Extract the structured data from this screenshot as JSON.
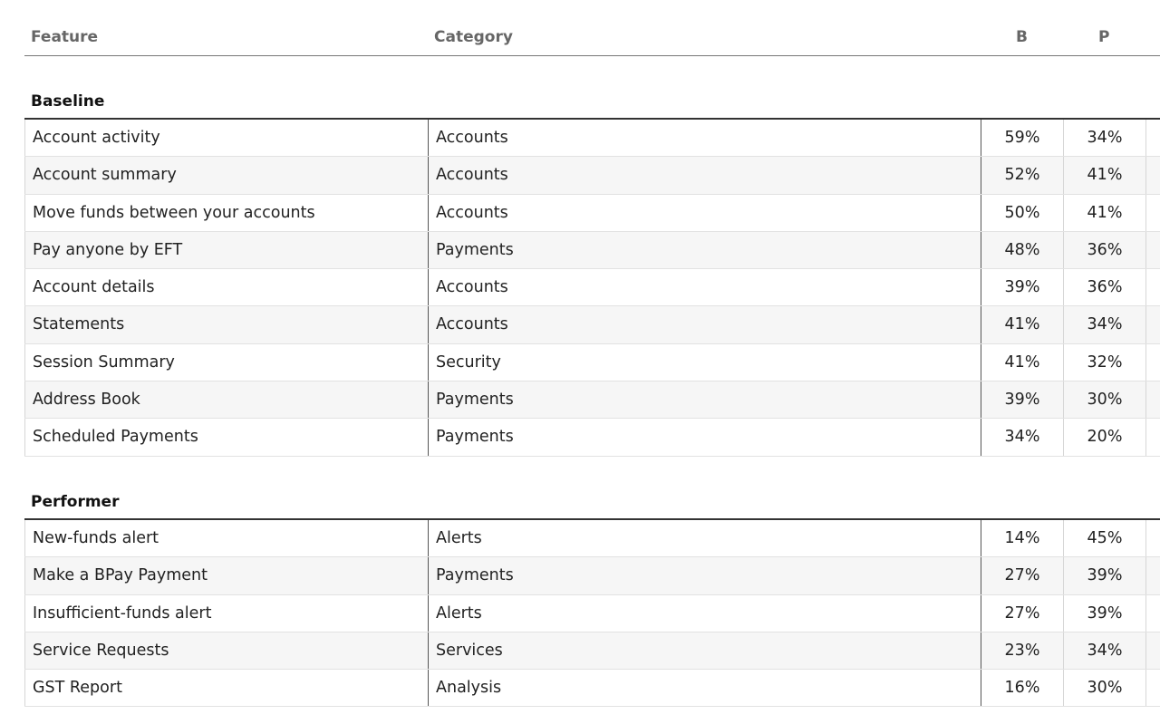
{
  "columns": {
    "feature": "Feature",
    "category": "Category",
    "b": "B",
    "p": "P"
  },
  "groups": [
    {
      "title": "Baseline",
      "rows": [
        {
          "feature": "Account activity",
          "category": "Accounts",
          "b": "59%",
          "p": "34%"
        },
        {
          "feature": "Account summary",
          "category": "Accounts",
          "b": "52%",
          "p": "41%"
        },
        {
          "feature": "Move funds between your accounts",
          "category": "Accounts",
          "b": "50%",
          "p": "41%"
        },
        {
          "feature": "Pay anyone by EFT",
          "category": "Payments",
          "b": "48%",
          "p": "36%"
        },
        {
          "feature": "Account details",
          "category": "Accounts",
          "b": "39%",
          "p": "36%"
        },
        {
          "feature": "Statements",
          "category": "Accounts",
          "b": "41%",
          "p": "34%"
        },
        {
          "feature": "Session Summary",
          "category": "Security",
          "b": "41%",
          "p": "32%"
        },
        {
          "feature": "Address Book",
          "category": "Payments",
          "b": "39%",
          "p": "30%"
        },
        {
          "feature": "Scheduled Payments",
          "category": "Payments",
          "b": "34%",
          "p": "20%"
        }
      ]
    },
    {
      "title": "Performer",
      "rows": [
        {
          "feature": "New-funds alert",
          "category": "Alerts",
          "b": "14%",
          "p": "45%"
        },
        {
          "feature": "Make a BPay Payment",
          "category": "Payments",
          "b": "27%",
          "p": "39%"
        },
        {
          "feature": "Insufficient-funds alert",
          "category": "Alerts",
          "b": "27%",
          "p": "39%"
        },
        {
          "feature": "Service Requests",
          "category": "Services",
          "b": "23%",
          "p": "34%"
        },
        {
          "feature": "GST Report",
          "category": "Analysis",
          "b": "16%",
          "p": "30%"
        }
      ]
    }
  ]
}
